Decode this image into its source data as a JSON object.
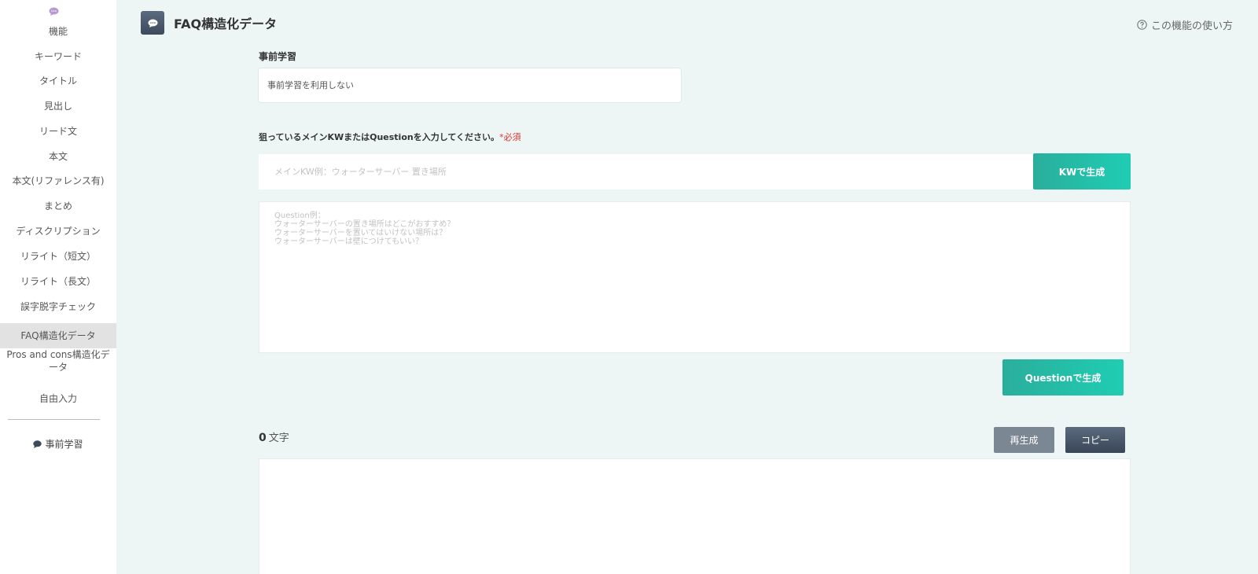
{
  "sidebar": {
    "items": [
      {
        "label": "機能"
      },
      {
        "label": "キーワード"
      },
      {
        "label": "タイトル"
      },
      {
        "label": "見出し"
      },
      {
        "label": "リード文"
      },
      {
        "label": "本文"
      },
      {
        "label": "本文(リファレンス有)"
      },
      {
        "label": "まとめ"
      },
      {
        "label": "ディスクリプション"
      },
      {
        "label": "リライト（短文）"
      },
      {
        "label": "リライト（長文）"
      },
      {
        "label": "誤字脱字チェック"
      },
      {
        "label": "FAQ構造化データ"
      },
      {
        "label": "Pros and cons構造化データ"
      },
      {
        "label": "自由入力"
      }
    ],
    "active_index": 12,
    "pre_learning_link": "事前学習",
    "icon": "chat-bubble-icon"
  },
  "header": {
    "title": "FAQ構造化データ",
    "icon": "chat-bubble-icon",
    "help_label": "この機能の使い方"
  },
  "pre_learning": {
    "label": "事前学習",
    "selected_value": "事前学習を利用しない"
  },
  "keyword": {
    "prompt": "狙っているメインKWまたはQuestionを入力してください。",
    "required": "*必須",
    "placeholder": "メインKW例：ウォーターサーバー 置き場所",
    "value": "",
    "generate_button": "KWで生成"
  },
  "question": {
    "placeholder": "Question例：\nウォーターサーバーの置き場所はどこがおすすめ？\nウォーターサーバーを置いてはいけない場所は？\nウォーターサーバーは壁につけてもいい？",
    "value": "",
    "generate_button": "Questionで生成"
  },
  "output": {
    "char_count": "0",
    "char_unit": "文字",
    "regenerate_button": "再生成",
    "copy_button": "コピー",
    "content": ""
  },
  "colors": {
    "accent_teal": "#22bfa8",
    "background": "#eef6f5",
    "required_red": "#d9362d",
    "dark_button": "#46536a",
    "gray_button": "#7c8794"
  }
}
